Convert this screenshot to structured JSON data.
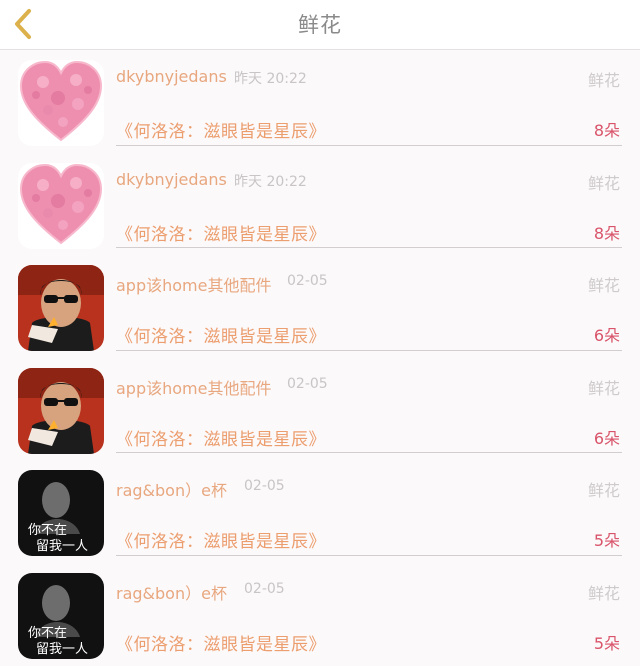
{
  "header": {
    "title": "鲜花",
    "back_icon": "chevron-left-icon",
    "accent": "#e0b347"
  },
  "colors": {
    "username": "#e8a77f",
    "song": "#ec9e6f",
    "count": "#d9546a",
    "muted": "#c9c5c6"
  },
  "items": [
    {
      "avatar": "heart-avatar",
      "user": "dkybnyjedans",
      "time": "昨天 20:22",
      "gift": "鲜花",
      "song": "《何洛洛：滋眼皆是星辰》",
      "count": "8朵"
    },
    {
      "avatar": "heart-avatar",
      "user": "dkybnyjedans",
      "time": "昨天 20:22",
      "gift": "鲜花",
      "song": "《何洛洛：滋眼皆是星辰》",
      "count": "8朵"
    },
    {
      "avatar": "man-avatar",
      "user": "app该home其他配件",
      "time": "02-05",
      "gift": "鲜花",
      "song": "《何洛洛：滋眼皆是星辰》",
      "count": "6朵"
    },
    {
      "avatar": "man-avatar",
      "user": "app该home其他配件",
      "time": "02-05",
      "gift": "鲜花",
      "song": "《何洛洛：滋眼皆是星辰》",
      "count": "6朵"
    },
    {
      "avatar": "bw-avatar",
      "user": "rag&bon）e杯",
      "time": "02-05",
      "gift": "鲜花",
      "song": "《何洛洛：滋眼皆是星辰》",
      "count": "5朵"
    },
    {
      "avatar": "bw-avatar",
      "user": "rag&bon）e杯",
      "time": "02-05",
      "gift": "鲜花",
      "song": "《何洛洛：滋眼皆是星辰》",
      "count": "5朵"
    }
  ],
  "avatar_text": {
    "line1": "你不在",
    "line2": "留我一人"
  }
}
